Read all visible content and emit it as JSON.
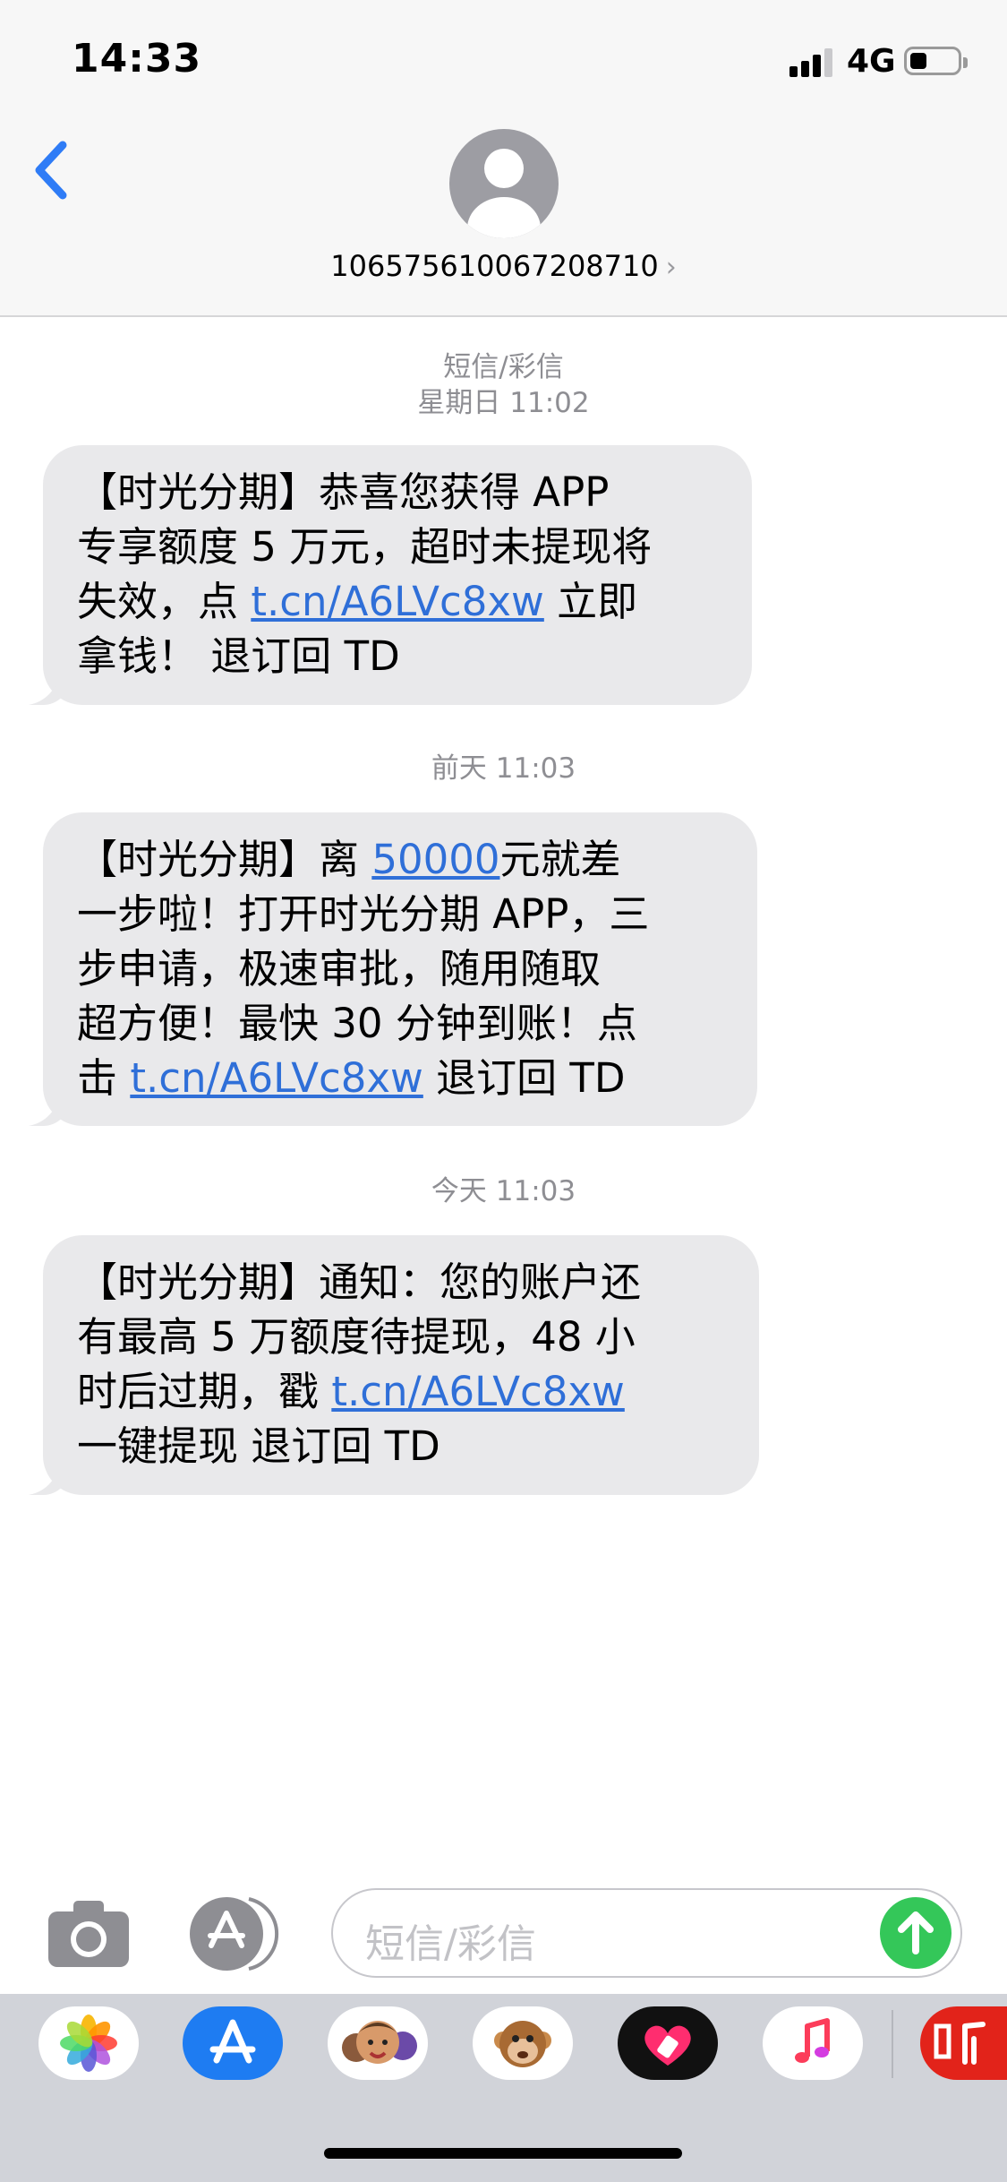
{
  "status_bar": {
    "time": "14:33",
    "network": "4G",
    "battery_level": 0.35
  },
  "header": {
    "contact": "106575610067208710",
    "chevron": "›"
  },
  "messages": [
    {
      "timestamp_label": "短信/彩信",
      "timestamp": "星期日 11:02",
      "parts": [
        "【时光分期】恭喜您获得 APP",
        "专享额度 5 万元，超时未提现将",
        "失效，点 ",
        "t.cn/A6LVc8xw",
        " 立即",
        "拿钱！ 退订回 TD"
      ]
    },
    {
      "timestamp": "前天 11:03",
      "parts": [
        "【时光分期】离 ",
        "50000",
        "元就差",
        "一步啦！打开时光分期 APP，三",
        "步申请，极速审批，随用随取",
        "超方便！最快 30 分钟到账！点",
        "击 ",
        "t.cn/A6LVc8xw",
        " 退订回 TD"
      ]
    },
    {
      "timestamp": "今天 11:03",
      "parts": [
        "【时光分期】通知：您的账户还",
        "有最高 5 万额度待提现，48 小",
        "时后过期，戳 ",
        "t.cn/A6LVc8xw",
        "一键提现 退订回 TD"
      ]
    }
  ],
  "composer": {
    "placeholder": "短信/彩信"
  },
  "icons": {
    "back": "chevron-left-icon",
    "camera": "camera-icon",
    "apps": "app-store-icon",
    "send": "arrow-up-icon",
    "dock": [
      "photos-icon",
      "app-store-icon",
      "memoji-icon",
      "animoji-icon",
      "heart-sticker-icon",
      "music-icon",
      "ting-app-icon"
    ]
  },
  "colors": {
    "accent": "#2f6fd8",
    "send": "#34c759",
    "bubble": "#e9e9eb",
    "timestamp": "#8e8e93"
  }
}
